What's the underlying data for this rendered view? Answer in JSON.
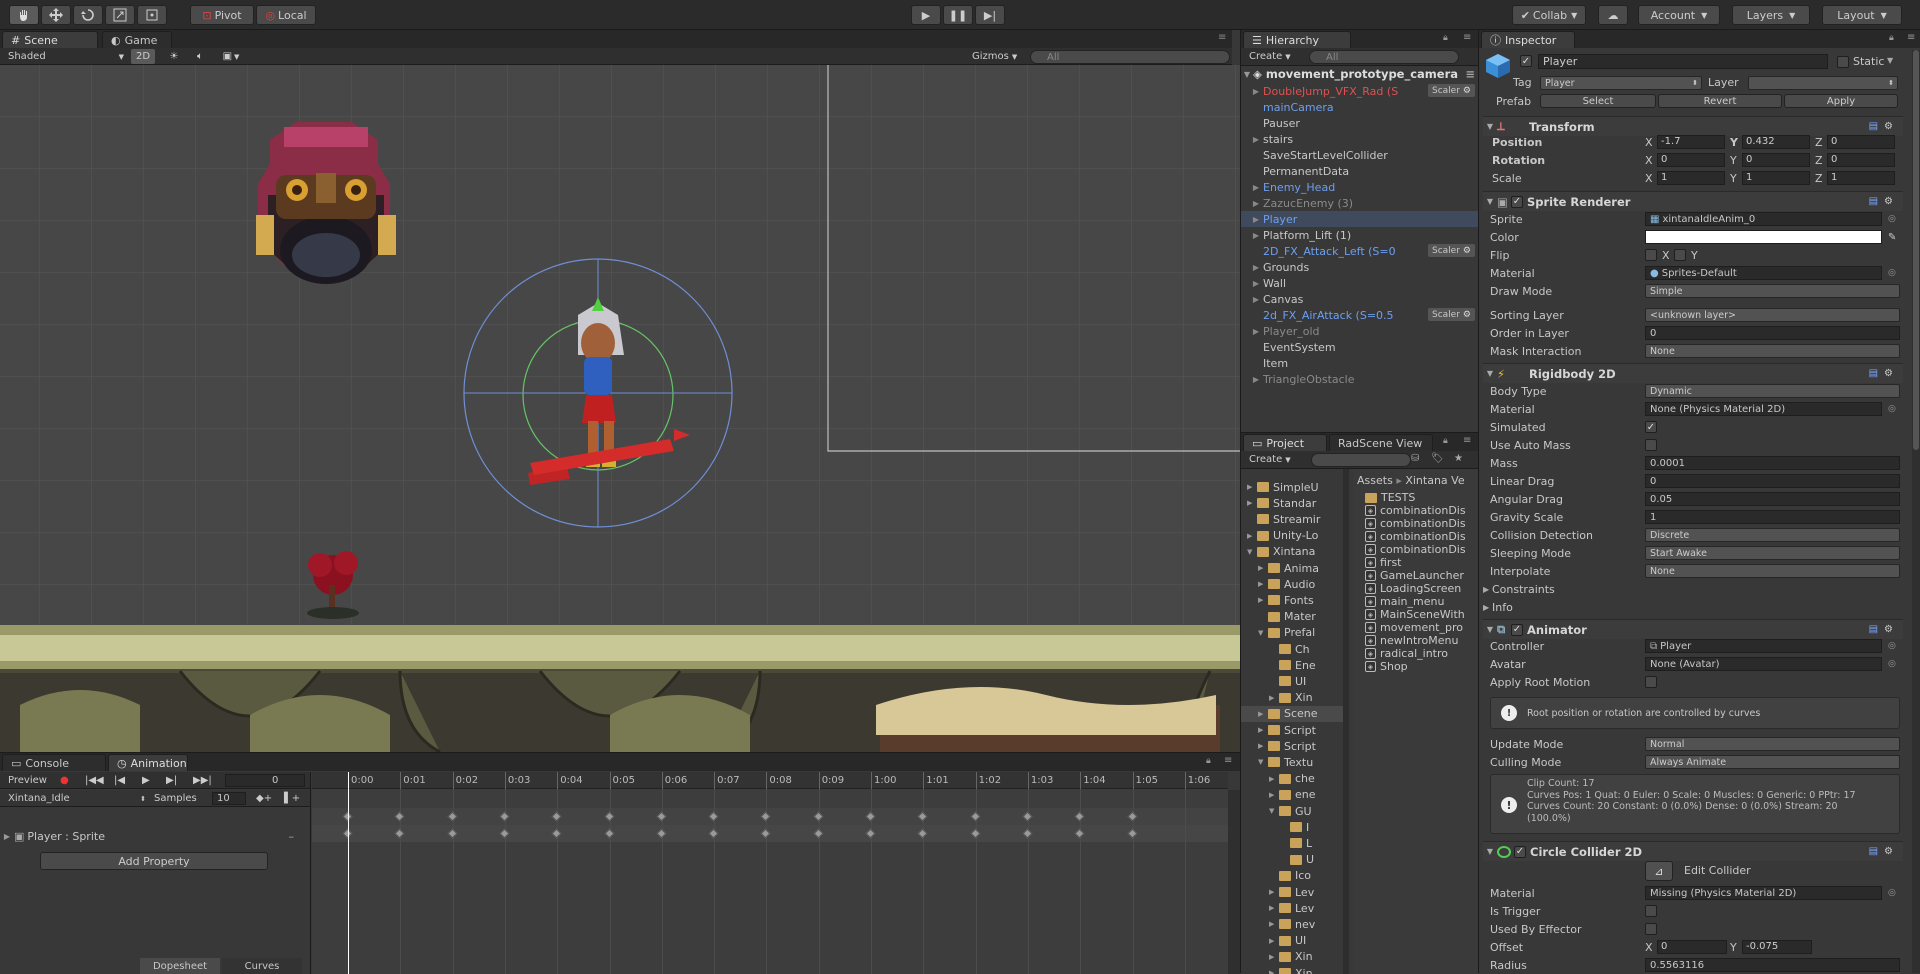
{
  "toolbar": {
    "pivot": "Pivot",
    "local": "Local",
    "collab": "Collab",
    "account": "Account",
    "layers": "Layers",
    "layout": "Layout"
  },
  "scene_panel": {
    "tab_scene": "Scene",
    "tab_game": "Game",
    "shading": "Shaded",
    "mode_2d": "2D",
    "gizmos": "Gizmos",
    "search_placeholder": "All"
  },
  "hierarchy": {
    "tab": "Hierarchy",
    "create": "Create",
    "search_placeholder": "All",
    "scene_name": "movement_prototype_camera",
    "scaler_label": "Scaler",
    "items": [
      {
        "label": "DoubleJump_VFX_Rad (S",
        "tri": "▶",
        "color": "red",
        "scaler": true
      },
      {
        "label": "mainCamera",
        "tri": "",
        "color": "blue",
        "scaler": false
      },
      {
        "label": "Pauser",
        "tri": "",
        "color": "",
        "scaler": false
      },
      {
        "label": "stairs",
        "tri": "▶",
        "color": "",
        "scaler": false
      },
      {
        "label": "SaveStartLevelCollider",
        "tri": "",
        "color": "",
        "scaler": false
      },
      {
        "label": "PermanentData",
        "tri": "",
        "color": "",
        "scaler": false
      },
      {
        "label": "Enemy_Head",
        "tri": "▶",
        "color": "blue",
        "scaler": false
      },
      {
        "label": "ZazucEnemy (3)",
        "tri": "▶",
        "color": "grey",
        "scaler": false
      },
      {
        "label": "Player",
        "tri": "▶",
        "color": "blue",
        "scaler": false,
        "selected": true
      },
      {
        "label": "Platform_Lift (1)",
        "tri": "▶",
        "color": "",
        "scaler": false
      },
      {
        "label": "2D_FX_Attack_Left (S=0",
        "tri": "",
        "color": "blue",
        "scaler": true
      },
      {
        "label": "Grounds",
        "tri": "▶",
        "color": "",
        "scaler": false
      },
      {
        "label": "Wall",
        "tri": "▶",
        "color": "",
        "scaler": false
      },
      {
        "label": "Canvas",
        "tri": "▶",
        "color": "",
        "scaler": false
      },
      {
        "label": "2d_FX_AirAttack (S=0.5",
        "tri": "",
        "color": "blue",
        "scaler": true
      },
      {
        "label": "Player_old",
        "tri": "▶",
        "color": "grey",
        "scaler": false
      },
      {
        "label": "EventSystem",
        "tri": "",
        "color": "",
        "scaler": false
      },
      {
        "label": "Item",
        "tri": "",
        "color": "",
        "scaler": false
      },
      {
        "label": "TriangleObstacle",
        "tri": "▶",
        "color": "grey",
        "scaler": false
      }
    ]
  },
  "project": {
    "tab": "Project",
    "tab2": "RadScene View",
    "create": "Create",
    "breadcrumb_assets": "Assets",
    "breadcrumb_sep": "▸",
    "breadcrumb_folder": "Xintana Ve",
    "tree": [
      {
        "label": "SimpleU",
        "indent": 0,
        "tri": "▶"
      },
      {
        "label": "Standar",
        "indent": 0,
        "tri": "▶"
      },
      {
        "label": "Streamir",
        "indent": 0,
        "tri": ""
      },
      {
        "label": "Unity-Lo",
        "indent": 0,
        "tri": "▶"
      },
      {
        "label": "Xintana",
        "indent": 0,
        "tri": "▼"
      },
      {
        "label": "Anima",
        "indent": 1,
        "tri": "▶"
      },
      {
        "label": "Audio",
        "indent": 1,
        "tri": "▶"
      },
      {
        "label": "Fonts",
        "indent": 1,
        "tri": "▶"
      },
      {
        "label": "Mater",
        "indent": 1,
        "tri": ""
      },
      {
        "label": "Prefal",
        "indent": 1,
        "tri": "▼"
      },
      {
        "label": "Ch",
        "indent": 2,
        "tri": ""
      },
      {
        "label": "Ene",
        "indent": 2,
        "tri": ""
      },
      {
        "label": "UI",
        "indent": 2,
        "tri": ""
      },
      {
        "label": "Xin",
        "indent": 2,
        "tri": "▶"
      },
      {
        "label": "Scene",
        "indent": 1,
        "tri": "▶",
        "selected": true
      },
      {
        "label": "Script",
        "indent": 1,
        "tri": "▶"
      },
      {
        "label": "Script",
        "indent": 1,
        "tri": "▶"
      },
      {
        "label": "Textu",
        "indent": 1,
        "tri": "▼"
      },
      {
        "label": "che",
        "indent": 2,
        "tri": "▶"
      },
      {
        "label": "ene",
        "indent": 2,
        "tri": "▶"
      },
      {
        "label": "GU",
        "indent": 2,
        "tri": "▼"
      },
      {
        "label": "I",
        "indent": 3,
        "tri": ""
      },
      {
        "label": "L",
        "indent": 3,
        "tri": ""
      },
      {
        "label": "U",
        "indent": 3,
        "tri": ""
      },
      {
        "label": "Ico",
        "indent": 2,
        "tri": ""
      },
      {
        "label": "Lev",
        "indent": 2,
        "tri": "▶"
      },
      {
        "label": "Lev",
        "indent": 2,
        "tri": "▶"
      },
      {
        "label": "nev",
        "indent": 2,
        "tri": "▶"
      },
      {
        "label": "UI",
        "indent": 2,
        "tri": "▶"
      },
      {
        "label": "Xin",
        "indent": 2,
        "tri": "▶"
      },
      {
        "label": "Xin",
        "indent": 2,
        "tri": "▶"
      }
    ],
    "files": [
      {
        "label": "TESTS",
        "kind": "folder"
      },
      {
        "label": "combinationDis",
        "kind": "scene"
      },
      {
        "label": "combinationDis",
        "kind": "scene"
      },
      {
        "label": "combinationDis",
        "kind": "scene"
      },
      {
        "label": "combinationDis",
        "kind": "scene"
      },
      {
        "label": "first",
        "kind": "scene"
      },
      {
        "label": "GameLauncher",
        "kind": "scene"
      },
      {
        "label": "LoadingScreen",
        "kind": "scene"
      },
      {
        "label": "main_menu",
        "kind": "scene"
      },
      {
        "label": "MainSceneWith",
        "kind": "scene"
      },
      {
        "label": "movement_pro",
        "kind": "scene"
      },
      {
        "label": "newIntroMenu",
        "kind": "scene"
      },
      {
        "label": "radical_intro",
        "kind": "scene"
      },
      {
        "label": "Shop",
        "kind": "scene"
      }
    ]
  },
  "inspector": {
    "tab": "Inspector",
    "object_name": "Player",
    "static_label": "Static",
    "tag_label": "Tag",
    "tag_value": "Player",
    "layer_label": "Layer",
    "layer_value": "",
    "prefab_label": "Prefab",
    "select": "Select",
    "revert": "Revert",
    "apply": "Apply",
    "transform": {
      "title": "Transform",
      "position_label": "Position",
      "rotation_label": "Rotation",
      "scale_label": "Scale",
      "position": {
        "x": "-1.7",
        "y": "0.432",
        "z": "0"
      },
      "rotation": {
        "x": "0",
        "y": "0",
        "z": "0"
      },
      "scale": {
        "x": "1",
        "y": "1",
        "z": "1"
      }
    },
    "sprite_renderer": {
      "title": "Sprite Renderer",
      "sprite_label": "Sprite",
      "sprite": "xintanaIdleAnim_0",
      "color_label": "Color",
      "flip_label": "Flip",
      "flip_x": "X",
      "flip_y": "Y",
      "material_label": "Material",
      "material": "Sprites-Default",
      "draw_mode_label": "Draw Mode",
      "draw_mode": "Simple",
      "sorting_layer_label": "Sorting Layer",
      "sorting_layer": "<unknown layer>",
      "order_label": "Order in Layer",
      "order": "0",
      "mask_label": "Mask Interaction",
      "mask": "None"
    },
    "rigidbody": {
      "title": "Rigidbody 2D",
      "body_type_label": "Body Type",
      "body_type": "Dynamic",
      "material_label": "Material",
      "material": "None (Physics Material 2D)",
      "simulated_label": "Simulated",
      "auto_mass_label": "Use Auto Mass",
      "mass_label": "Mass",
      "mass": "0.0001",
      "linear_drag_label": "Linear Drag",
      "linear_drag": "0",
      "angular_drag_label": "Angular Drag",
      "angular_drag": "0.05",
      "gravity_label": "Gravity Scale",
      "gravity": "1",
      "collision_label": "Collision Detection",
      "collision": "Discrete",
      "sleeping_label": "Sleeping Mode",
      "sleeping": "Start Awake",
      "interpolate_label": "Interpolate",
      "interpolate": "None",
      "constraints_label": "Constraints",
      "info_label": "Info"
    },
    "animator": {
      "title": "Animator",
      "controller_label": "Controller",
      "controller": "Player",
      "avatar_label": "Avatar",
      "avatar": "None (Avatar)",
      "root_motion_label": "Apply Root Motion",
      "help": "Root position or rotation are controlled by curves",
      "update_label": "Update Mode",
      "update": "Normal",
      "culling_label": "Culling Mode",
      "culling": "Always Animate",
      "clip_info": [
        "Clip Count: 17",
        "Curves Pos: 1 Quat: 0 Euler: 0 Scale: 0 Muscles: 0 Generic: 0 PPtr: 17",
        "Curves Count: 20 Constant: 0 (0.0%) Dense: 0 (0.0%) Stream: 20",
        "(100.0%)"
      ]
    },
    "circle_collider": {
      "title": "Circle Collider 2D",
      "edit_collider": "Edit Collider",
      "material_label": "Material",
      "material": "Missing (Physics Material 2D)",
      "is_trigger_label": "Is Trigger",
      "effector_label": "Used By Effector",
      "offset_label": "Offset",
      "offset_x": "0",
      "offset_y": "-0.075",
      "radius_label": "Radius",
      "radius": "0.5563116"
    }
  },
  "animation": {
    "tab_console": "Console",
    "tab_animation": "Animation",
    "preview": "Preview",
    "frame": "0",
    "clip": "Xintana_Idle",
    "samples_label": "Samples",
    "samples": "10",
    "property": "Player : Sprite",
    "add_property": "Add Property",
    "dopesheet": "Dopesheet",
    "curves": "Curves",
    "time_labels": [
      "0:00",
      "0:01",
      "0:02",
      "0:03",
      "0:04",
      "0:05",
      "0:06",
      "0:07",
      "0:08",
      "0:09",
      "1:00",
      "1:01",
      "1:02",
      "1:03",
      "1:04",
      "1:05",
      "1:06"
    ]
  },
  "colors": {
    "accent": "#3e7be0",
    "selection": "#3f4a5d",
    "scene_bg": "#474747",
    "panel_bg": "#383838"
  }
}
